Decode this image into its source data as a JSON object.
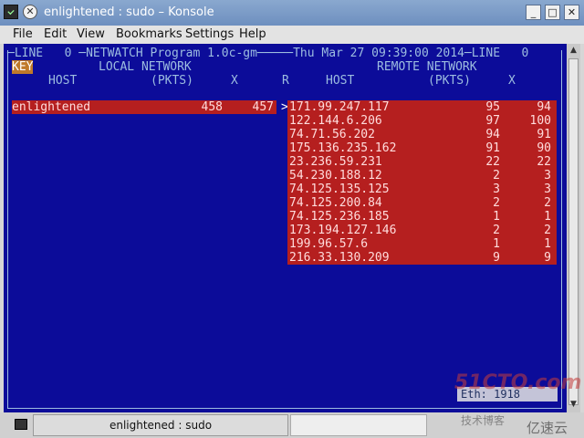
{
  "window": {
    "title": "enlightened : sudo – Konsole",
    "title_icon": "terminal-icon",
    "controls": [
      "_",
      "□",
      "✕"
    ]
  },
  "menu": [
    "File",
    "Edit",
    "View",
    "Bookmarks",
    "Settings",
    "Help"
  ],
  "netwatch": {
    "header_left": "─LINE   0 ─NETWATCH Program 1.0c-gm─────Thu Mar 27 09:39:00 2014─LINE   0",
    "key_label": "KEY",
    "local_network_label": "LOCAL NETWORK",
    "remote_network_label": "REMOTE NETWORK",
    "col_host": "HOST",
    "col_pkts": "(PKTS)",
    "col_x": "X",
    "col_r": "R",
    "local_rows": [
      {
        "host": "enlightened",
        "pkts": "458",
        "x": "457"
      }
    ],
    "marker": ">",
    "remote_rows": [
      {
        "host": "171.99.247.117",
        "pkts": "95",
        "x": "94"
      },
      {
        "host": "122.144.6.206",
        "pkts": "97",
        "x": "100"
      },
      {
        "host": "74.71.56.202",
        "pkts": "94",
        "x": "91"
      },
      {
        "host": "175.136.235.162",
        "pkts": "91",
        "x": "90"
      },
      {
        "host": "23.236.59.231",
        "pkts": "22",
        "x": "22"
      },
      {
        "host": "54.230.188.12",
        "pkts": "2",
        "x": "3"
      },
      {
        "host": "74.125.135.125",
        "pkts": "3",
        "x": "3"
      },
      {
        "host": "74.125.200.84",
        "pkts": "2",
        "x": "2"
      },
      {
        "host": "74.125.236.185",
        "pkts": "1",
        "x": "1"
      },
      {
        "host": "173.194.127.146",
        "pkts": "2",
        "x": "2"
      },
      {
        "host": "199.96.57.6",
        "pkts": "1",
        "x": "1"
      },
      {
        "host": "216.33.130.209",
        "pkts": "9",
        "x": "9"
      }
    ],
    "status": "Eth:       1918"
  },
  "tab": {
    "label": "enlightened : sudo"
  },
  "watermark": {
    "brand": "51CTO.com",
    "sub": "技术博客",
    "logo": "亿速云"
  },
  "colors": {
    "terminal_bg": "#0c0c99",
    "highlight": "#b51f1f",
    "text": "#9dbde0",
    "key": "#c07a2a"
  }
}
